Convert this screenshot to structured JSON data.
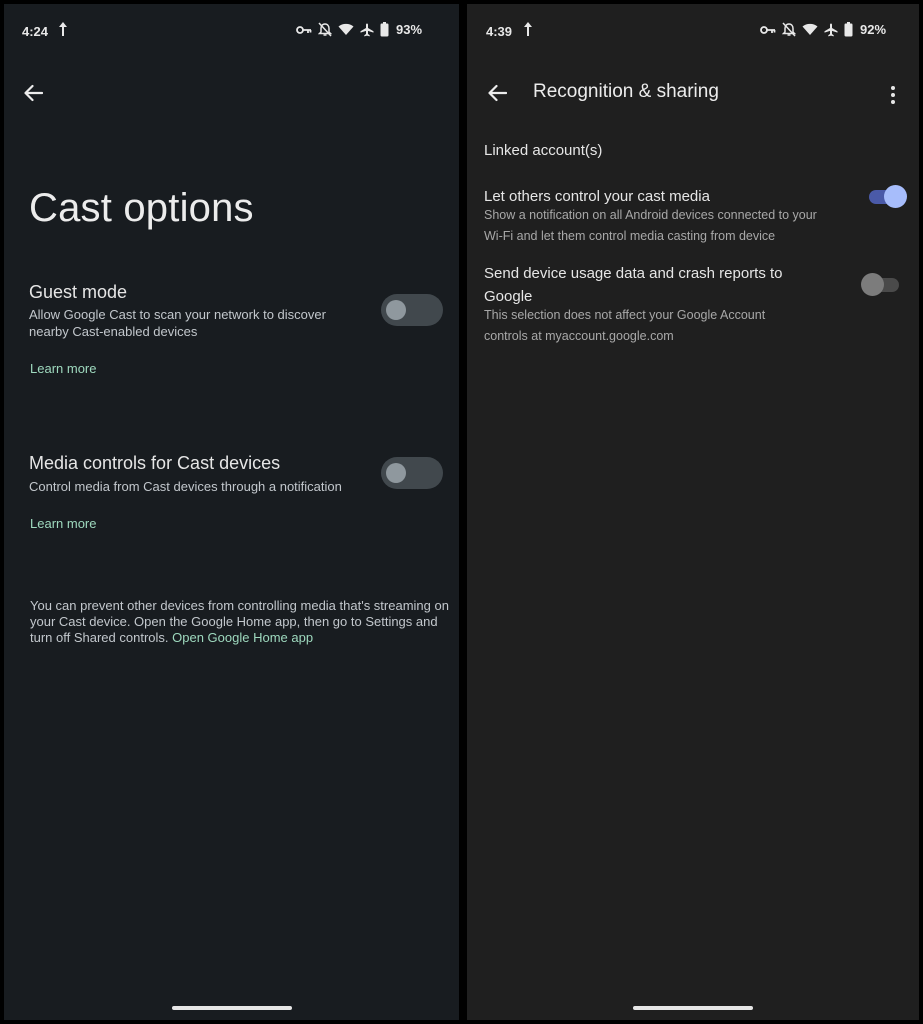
{
  "left_screen": {
    "status_bar": {
      "time": "4:24",
      "battery": "93%"
    },
    "title": "Cast options",
    "settings": [
      {
        "title": "Guest mode",
        "subtitle": "Allow Google Cast to scan your network to discover nearby Cast-enabled devices",
        "link": "Learn more",
        "enabled": false
      },
      {
        "title": "Media controls for Cast devices",
        "subtitle": "Control media from Cast devices through a notification",
        "link": "Learn more",
        "enabled": false
      }
    ],
    "footer": {
      "text": "You can prevent other devices from controlling media that's streaming on your Cast device. Open the Google Home app, then go to Settings and turn off Shared controls.",
      "link": "Open Google Home app"
    }
  },
  "right_screen": {
    "status_bar": {
      "time": "4:39",
      "battery": "92%"
    },
    "title": "Recognition & sharing",
    "linked_accounts": "Linked account(s)",
    "rows": [
      {
        "title": "Let others control your cast media",
        "subtitle": "Show a notification on all Android devices connected to your Wi-Fi and let them control media casting from device",
        "enabled": true
      },
      {
        "title": "Send device usage data and crash reports to Google",
        "subtitle": "This selection does not affect your Google Account controls at myaccount.google.com",
        "enabled": false
      }
    ]
  },
  "colors": {
    "left_background": "#181c20",
    "right_background": "#1f1f1f",
    "link_green": "#9ed9be",
    "switch_on_accent": "#a7bdfb"
  },
  "icons": [
    "arrow-up-icon",
    "vpn-key-icon",
    "notifications-off-icon",
    "wifi-icon",
    "airplane-icon",
    "battery-icon",
    "back-arrow-icon",
    "more-vert-icon"
  ]
}
